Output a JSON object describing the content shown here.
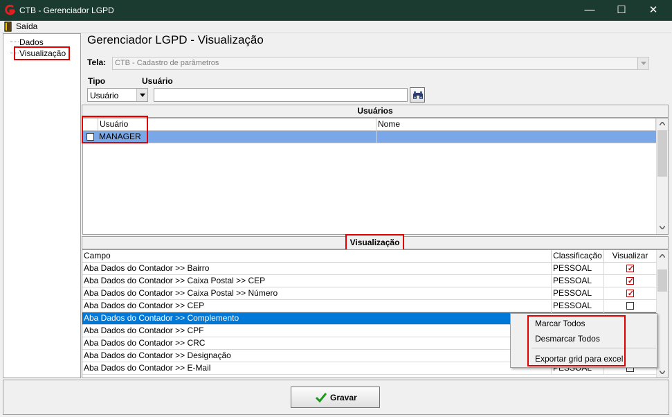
{
  "window": {
    "title": "CTB - Gerenciador LGPD",
    "minimize": "—",
    "maximize": "☐",
    "close": "✕"
  },
  "menu": {
    "exit_label": "Saída"
  },
  "tree": {
    "items": [
      "Dados",
      "Visualização"
    ]
  },
  "page": {
    "title": "Gerenciador LGPD - Visualização"
  },
  "tela": {
    "label": "Tela:",
    "value": "CTB - Cadastro de parâmetros"
  },
  "filters": {
    "tipo_label": "Tipo",
    "usuario_label": "Usuário",
    "tipo_value": "Usuário",
    "usuario_value": ""
  },
  "users_panel": {
    "header": "Usuários",
    "columns": [
      "Usuário",
      "Nome"
    ],
    "rows": [
      {
        "usuario": "MANAGER",
        "nome": "",
        "checked": false
      }
    ]
  },
  "vis_panel": {
    "header": "Visualização",
    "columns": [
      "Campo",
      "Classificação",
      "Visualizar"
    ],
    "rows": [
      {
        "campo": "Aba Dados do Contador >> Bairro",
        "classificacao": "PESSOAL",
        "visualizar": true
      },
      {
        "campo": "Aba Dados do Contador >> Caixa Postal >> CEP",
        "classificacao": "PESSOAL",
        "visualizar": true
      },
      {
        "campo": "Aba Dados do Contador >> Caixa Postal >> Número",
        "classificacao": "PESSOAL",
        "visualizar": true
      },
      {
        "campo": "Aba Dados do Contador >> CEP",
        "classificacao": "PESSOAL",
        "visualizar": false
      },
      {
        "campo": "Aba Dados do Contador >> Complemento",
        "classificacao": "",
        "visualizar": false
      },
      {
        "campo": "Aba Dados do Contador >> CPF",
        "classificacao": "",
        "visualizar": false
      },
      {
        "campo": "Aba Dados do Contador >> CRC",
        "classificacao": "",
        "visualizar": false
      },
      {
        "campo": "Aba Dados do Contador >> Designação",
        "classificacao": "",
        "visualizar": false
      },
      {
        "campo": "Aba Dados do Contador >> E-Mail",
        "classificacao": "PESSOAL",
        "visualizar": false
      }
    ]
  },
  "context_menu": {
    "items": [
      "Marcar Todos",
      "Desmarcar Todos",
      "Exportar grid para excel"
    ]
  },
  "footer": {
    "save_label": "Gravar"
  },
  "colors": {
    "titlebar": "#1b3a30",
    "selection": "#0078d7",
    "highlight": "#e00000"
  }
}
